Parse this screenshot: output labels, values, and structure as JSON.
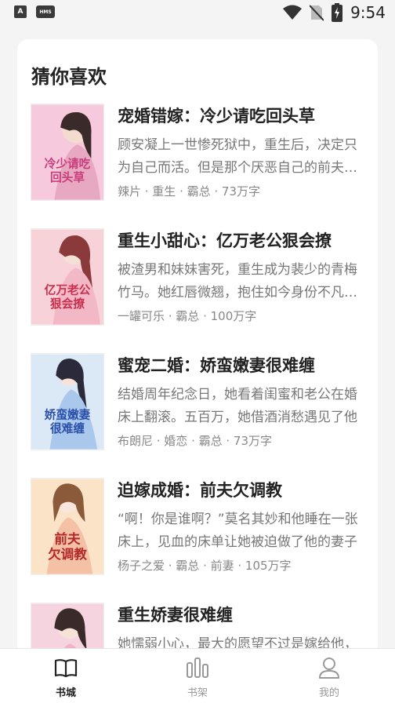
{
  "status_bar": {
    "time": "9:54",
    "app_badge_a": "A",
    "app_badge_hms": "HMS",
    "icons": [
      "wifi-icon",
      "no-sim-icon",
      "battery-charging-icon"
    ]
  },
  "section": {
    "title": "猜你喜欢"
  },
  "books": [
    {
      "title": "宠婚错嫁：冷少请吃回头草",
      "desc": "顾安凝上一世惨死狱中，重生后，决定只为自己而活。但是那个厌恶自己的前夫却开始对她死缠烂打",
      "meta": "辣片 · 重生 · 霸总 · 73万字",
      "cover_text": "冷少请吃回头草",
      "cover_color": "#f6c9dc"
    },
    {
      "title": "重生小甜心：亿万老公狠会撩",
      "desc": "被渣男和妹妹害死，重生成为裴少的青梅竹马。她红唇微翘，抱住如今身份不凡的他",
      "meta": "一罐可乐 · 霸总 · 100万字",
      "cover_text": "亿万老公狠会撩",
      "cover_color": "#f7d2d9"
    },
    {
      "title": "蜜宠二婚：娇蛮嫩妻很难缠",
      "desc": "结婚周年纪念日，她看着闺蜜和老公在婚床上翻滚。五百万，她借酒消愁遇见了他",
      "meta": "布朗尼 · 婚恋 · 霸总 · 73万字",
      "cover_text": "娇蛮嫩妻很难缠",
      "cover_color": "#dbe8f6"
    },
    {
      "title": "迫嫁成婚：前夫欠调教",
      "desc": "“啊！你是谁啊？”莫名其妙和他睡在一张床上，见血的床单让她被迫做了他的妻子",
      "meta": "杨子之爱 · 霸总 · 前妻 · 105万字",
      "cover_text": "前夫欠调教",
      "cover_color": "#fbe3c8"
    },
    {
      "title": "重生娇妻很难缠",
      "desc": "她懦弱小心，最大的愿望不过是嫁给他，却没想到换来的是满身伤痕",
      "meta": "",
      "cover_text": "",
      "cover_color": "#f6d4df"
    }
  ],
  "tabs": [
    {
      "label": "书城",
      "icon": "book-open-icon",
      "active": true
    },
    {
      "label": "书架",
      "icon": "bookshelf-icon",
      "active": false
    },
    {
      "label": "我的",
      "icon": "user-icon",
      "active": false
    }
  ],
  "colors": {
    "background": "#f4f4f4",
    "card": "#ffffff",
    "title_text": "#222222",
    "desc_text": "#777777",
    "tab_inactive": "#999999"
  }
}
